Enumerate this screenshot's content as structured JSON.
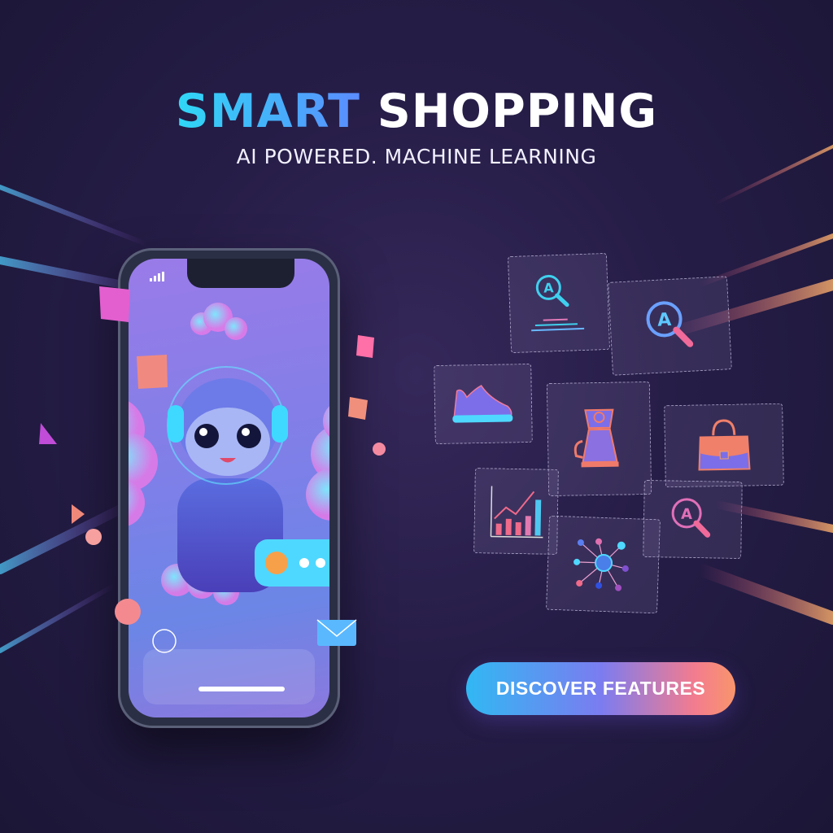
{
  "headline": {
    "accent": "SMART",
    "rest": "SHOPPING"
  },
  "subheadline": "AI POWERED. MACHINE LEARNING",
  "cta": {
    "label": "DISCOVER FEATURES"
  },
  "colors": {
    "accent_cyan": "#2fd8f5",
    "accent_blue": "#5b8cff",
    "cta_start": "#31b8f3",
    "cta_end": "#f8956c",
    "background": "#261d47"
  },
  "feature_cards": [
    {
      "icon": "ai-search-document-icon"
    },
    {
      "icon": "ai-search-icon"
    },
    {
      "icon": "sneaker-icon"
    },
    {
      "icon": "kettle-icon"
    },
    {
      "icon": "handbag-icon"
    },
    {
      "icon": "growth-chart-icon"
    },
    {
      "icon": "neural-network-icon"
    },
    {
      "icon": "ai-search-icon"
    }
  ]
}
